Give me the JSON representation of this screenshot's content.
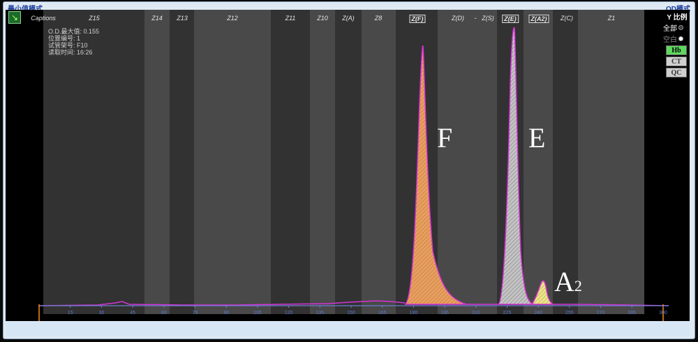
{
  "window": {
    "title_left": "最小值模式",
    "title_right": "OD模式"
  },
  "captions_label": "Captions",
  "zones": [
    "Z15",
    "Z14",
    "Z13",
    "Z12",
    "Z11",
    "Z10",
    "Z(A)",
    "Z8",
    "Z(F)",
    "Z(D)",
    "-",
    "Z(S)",
    "Z(E)",
    "Z(A2)",
    "Z(C)",
    "Z1"
  ],
  "info": {
    "od_max": "O.D.最大值: 0.155",
    "position": "位置编号: 1",
    "tube_rack": "试管架号: F10",
    "read_time": "读取时间: 16:26"
  },
  "right_panel": {
    "title": "Y 比例",
    "opt_all": "全部",
    "opt_empty": "空白",
    "btn_hb": "Hb",
    "btn_ct": "CT",
    "btn_qc": "QC"
  },
  "peaks": {
    "f": "F",
    "e": "E",
    "a": "A",
    "a_sub": "2"
  },
  "x_ticks": [
    "15",
    "30",
    "45",
    "60",
    "75",
    "90",
    "105",
    "120",
    "135",
    "150",
    "165",
    "180",
    "195",
    "210",
    "225",
    "240",
    "255",
    "270",
    "285",
    "300"
  ],
  "colors": {
    "trace": "#d633d6",
    "peak_f_fill": "#e8a060",
    "peak_e_fill": "#b8b8b8",
    "peak_a2_fill": "#e6df80",
    "axis": "#6a7fd0",
    "tick_label": "#5a78c8",
    "zone_dark": "#323232",
    "zone_light": "#494949"
  }
}
